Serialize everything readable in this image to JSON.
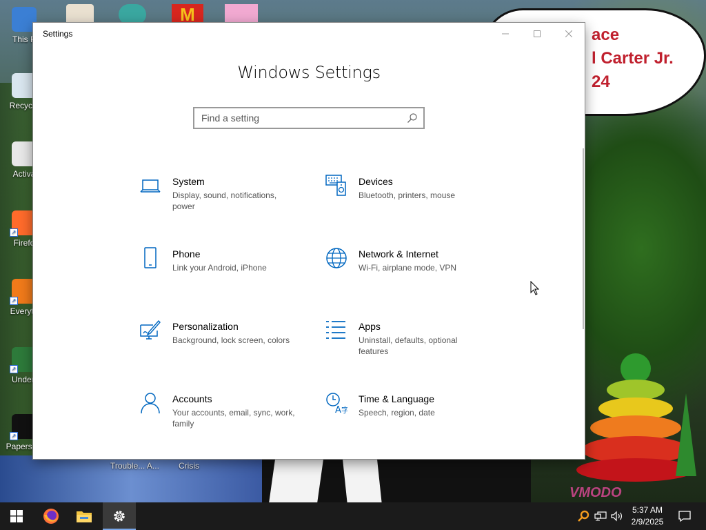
{
  "desktop": {
    "icons": [
      {
        "label": "This P",
        "color": "#3b7fd4"
      },
      {
        "label": "Recycle",
        "color": "#d9e6ef"
      },
      {
        "label": "Activa",
        "color": "#e8e8e8"
      },
      {
        "label": "Firefo",
        "color": "#ff6b2b"
      },
      {
        "label": "Everyth",
        "color": "#f07a1a"
      },
      {
        "label": "Undert",
        "color": "#2d7a3a"
      },
      {
        "label": "Papers, P",
        "color": "#111111"
      }
    ],
    "under_window_labels": [
      "Trouble... A...",
      "Crisis"
    ],
    "wallpaper_text": "ace\nl Carter Jr.\n24",
    "watermark": "VMODO"
  },
  "window": {
    "title": "Settings",
    "heading": "Windows Settings",
    "search_placeholder": "Find a setting",
    "controls": {
      "minimize": "—",
      "maximize": "☐",
      "close": "✕"
    },
    "categories": [
      {
        "title": "System",
        "desc": "Display, sound, notifications, power",
        "icon": "laptop-icon"
      },
      {
        "title": "Devices",
        "desc": "Bluetooth, printers, mouse",
        "icon": "devices-icon"
      },
      {
        "title": "Phone",
        "desc": "Link your Android, iPhone",
        "icon": "phone-icon"
      },
      {
        "title": "Network & Internet",
        "desc": "Wi-Fi, airplane mode, VPN",
        "icon": "globe-icon"
      },
      {
        "title": "Personalization",
        "desc": "Background, lock screen, colors",
        "icon": "personalization-icon"
      },
      {
        "title": "Apps",
        "desc": "Uninstall, defaults, optional features",
        "icon": "apps-icon"
      },
      {
        "title": "Accounts",
        "desc": "Your accounts, email, sync, work, family",
        "icon": "person-icon"
      },
      {
        "title": "Time & Language",
        "desc": "Speech, region, date",
        "icon": "time-language-icon"
      }
    ],
    "accent": "#0067c0"
  },
  "taskbar": {
    "items": [
      "start-icon",
      "firefox-icon",
      "file-explorer-icon",
      "settings-icon"
    ],
    "time": "5:37 AM",
    "date": "2/9/2025"
  }
}
